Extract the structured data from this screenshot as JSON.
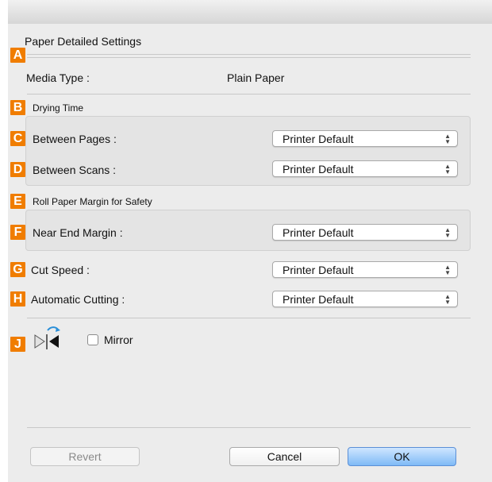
{
  "dialog": {
    "section_title": "Paper Detailed Settings"
  },
  "badges": {
    "a": "A",
    "b": "B",
    "c": "C",
    "d": "D",
    "e": "E",
    "f": "F",
    "g": "G",
    "h": "H",
    "j": "J"
  },
  "media_type": {
    "label": "Media Type :",
    "value": "Plain Paper"
  },
  "drying_time": {
    "group_label": "Drying Time",
    "between_pages_label": "Between Pages :",
    "between_pages_value": "Printer Default",
    "between_scans_label": "Between Scans :",
    "between_scans_value": "Printer Default"
  },
  "roll_margin": {
    "group_label": "Roll Paper Margin for Safety",
    "near_end_label": "Near End Margin :",
    "near_end_value": "Printer Default"
  },
  "cut_speed": {
    "label": "Cut Speed :",
    "value": "Printer Default"
  },
  "automatic_cutting": {
    "label": "Automatic Cutting :",
    "value": "Printer Default"
  },
  "mirror": {
    "label": "Mirror",
    "checked": false,
    "icon": "mirror-flip-icon"
  },
  "buttons": {
    "revert": "Revert",
    "cancel": "Cancel",
    "ok": "OK"
  },
  "colors": {
    "badge": "#f07d00",
    "ok_button": "#7fbaf6"
  }
}
